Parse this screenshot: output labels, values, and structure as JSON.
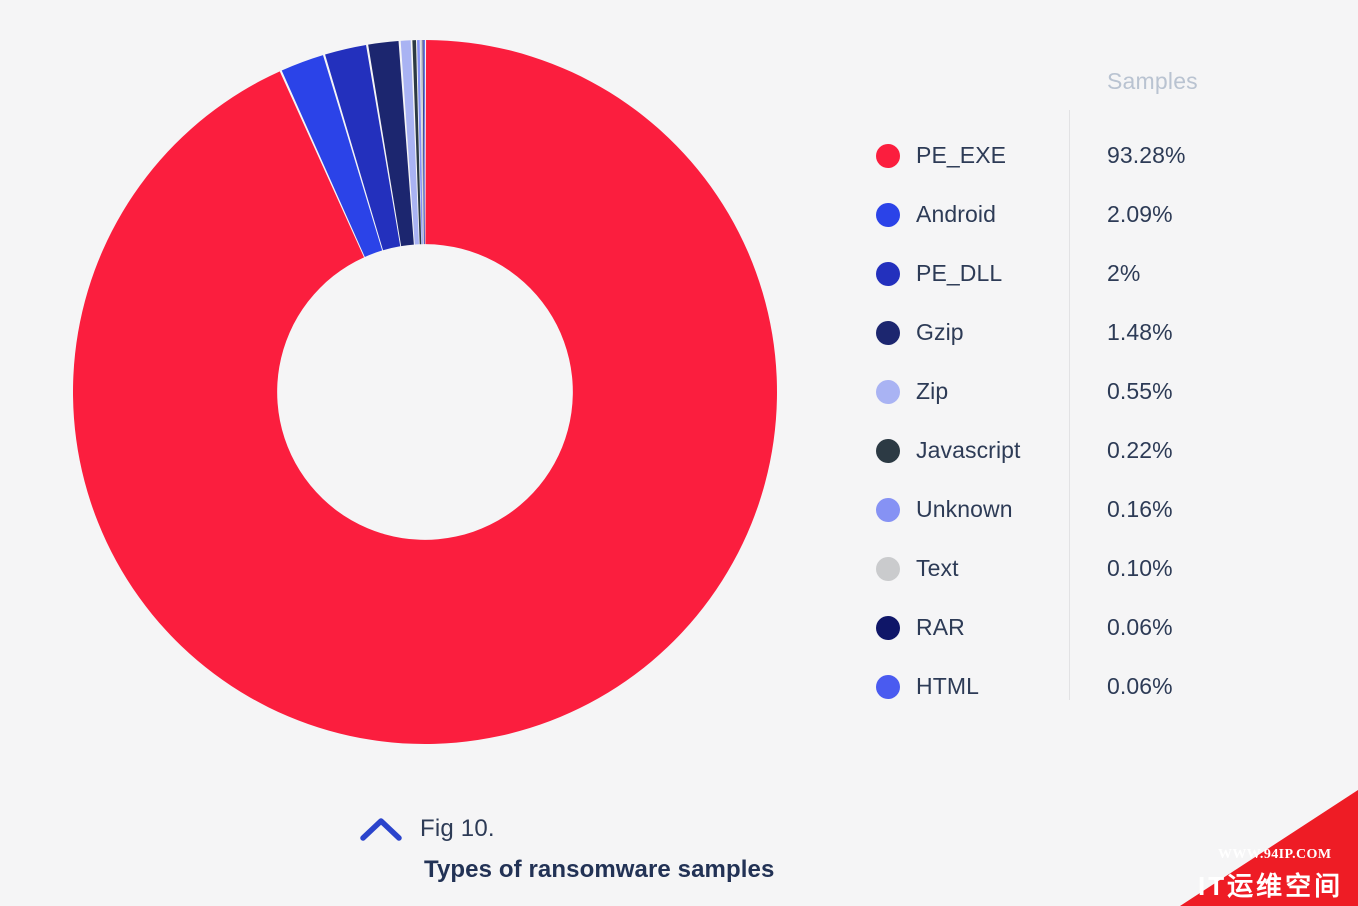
{
  "background_color": "#f5f5f6",
  "legend": {
    "header": "Samples",
    "header_color": "#b9c3d1",
    "text_color": "#2d3b56"
  },
  "caption": {
    "icon": "chevron-up-icon",
    "icon_color": "#2b44cc",
    "figure_number": "Fig 10.",
    "title": "Types of ransomware samples"
  },
  "watermark": {
    "url": "WWW.94IP.COM",
    "name": "IT运维空间",
    "color": "#ee1c25"
  },
  "chart_data": {
    "type": "pie",
    "variant": "donut",
    "title": "Types of ransomware samples",
    "subtitle": "Fig 10.",
    "value_column_header": "Samples",
    "units": "percent",
    "legend_position": "right",
    "start_angle_deg": -90,
    "direction": "clockwise",
    "inner_radius_ratio": 0.42,
    "categories": [
      "PE_EXE",
      "Android",
      "PE_DLL",
      "Gzip",
      "Zip",
      "Javascript",
      "Unknown",
      "Text",
      "RAR",
      "HTML"
    ],
    "values": [
      93.28,
      2.09,
      2.0,
      1.48,
      0.55,
      0.22,
      0.16,
      0.1,
      0.06,
      0.06
    ],
    "labels": [
      "93.28%",
      "2.09%",
      "2%",
      "1.48%",
      "0.55%",
      "0.22%",
      "0.16%",
      "0.10%",
      "0.06%",
      "0.06%"
    ],
    "colors": [
      "#fb1e3e",
      "#2b43e8",
      "#2330bd",
      "#1c266f",
      "#a9b3f3",
      "#2c3a44",
      "#8692f4",
      "#cacbcd",
      "#0f1668",
      "#4a5bf0"
    ],
    "slices": [
      {
        "label": "PE_EXE",
        "value": 93.28,
        "display": "93.28%",
        "color": "#fb1e3e"
      },
      {
        "label": "Android",
        "value": 2.09,
        "display": "2.09%",
        "color": "#2b43e8"
      },
      {
        "label": "PE_DLL",
        "value": 2.0,
        "display": "2%",
        "color": "#2330bd"
      },
      {
        "label": "Gzip",
        "value": 1.48,
        "display": "1.48%",
        "color": "#1c266f"
      },
      {
        "label": "Zip",
        "value": 0.55,
        "display": "0.55%",
        "color": "#a9b3f3"
      },
      {
        "label": "Javascript",
        "value": 0.22,
        "display": "0.22%",
        "color": "#2c3a44"
      },
      {
        "label": "Unknown",
        "value": 0.16,
        "display": "0.16%",
        "color": "#8692f4"
      },
      {
        "label": "Text",
        "value": 0.1,
        "display": "0.10%",
        "color": "#cacbcd"
      },
      {
        "label": "RAR",
        "value": 0.06,
        "display": "0.06%",
        "color": "#0f1668"
      },
      {
        "label": "HTML",
        "value": 0.06,
        "display": "0.06%",
        "color": "#4a5bf0"
      }
    ]
  }
}
